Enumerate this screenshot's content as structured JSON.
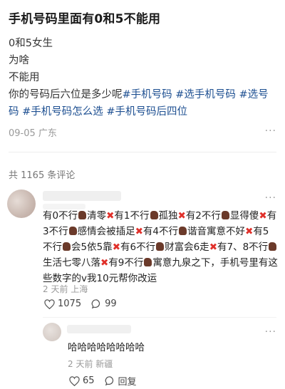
{
  "post": {
    "title": "手机号码里面有0和5不能用",
    "lines": [
      "0和5女生",
      "为啥",
      "不能用"
    ],
    "body_prefix": "你的号码后六位是多少呢",
    "tags": [
      "#手机号码",
      "#选手机号码",
      "#选号码",
      "#手机号码怎么选",
      "#手机号码后四位"
    ],
    "date": "09-05",
    "location": "广东",
    "more": "···"
  },
  "comments_header": "共 1165 条评论",
  "comment": {
    "segments": [
      {
        "t": "有0不行"
      },
      {
        "i": "fist-icon"
      },
      {
        "t": "清零"
      },
      {
        "i": "cross-icon"
      },
      {
        "t": "有1不行"
      },
      {
        "i": "fist-icon"
      },
      {
        "t": "孤独"
      },
      {
        "i": "cross-icon"
      },
      {
        "t": "有2不行"
      },
      {
        "i": "fist-icon"
      },
      {
        "t": "显得傻"
      },
      {
        "i": "cross-icon"
      },
      {
        "t": "有3不行"
      },
      {
        "i": "fist-icon"
      },
      {
        "t": "感情会被插足"
      },
      {
        "i": "cross-icon"
      },
      {
        "t": "有4不行"
      },
      {
        "i": "fist-icon"
      },
      {
        "t": "谐音寓意不好"
      },
      {
        "i": "cross-icon"
      },
      {
        "t": "有5不行"
      },
      {
        "i": "fist-icon"
      },
      {
        "t": "会5依5靠"
      },
      {
        "i": "cross-icon"
      },
      {
        "t": "有6不行"
      },
      {
        "i": "fist-icon"
      },
      {
        "t": "财富会6走"
      },
      {
        "i": "cross-icon"
      },
      {
        "t": "有7、8不行"
      },
      {
        "i": "fist-icon"
      },
      {
        "t": "生活七零八落"
      },
      {
        "i": "cross-icon"
      },
      {
        "t": "有9不行"
      },
      {
        "i": "fist-icon"
      },
      {
        "t": "寓意九泉之下，手机号里有这些数字的v我10元帮你改运"
      }
    ],
    "time": "2 天前",
    "location": "上海",
    "likes": "1075",
    "replies": "99",
    "more": "···"
  },
  "reply": {
    "text": "哈哈哈哈哈哈哈哈",
    "time": "2 天前",
    "location": "新疆",
    "likes": "65",
    "reply_label": "回复",
    "more": "···"
  }
}
